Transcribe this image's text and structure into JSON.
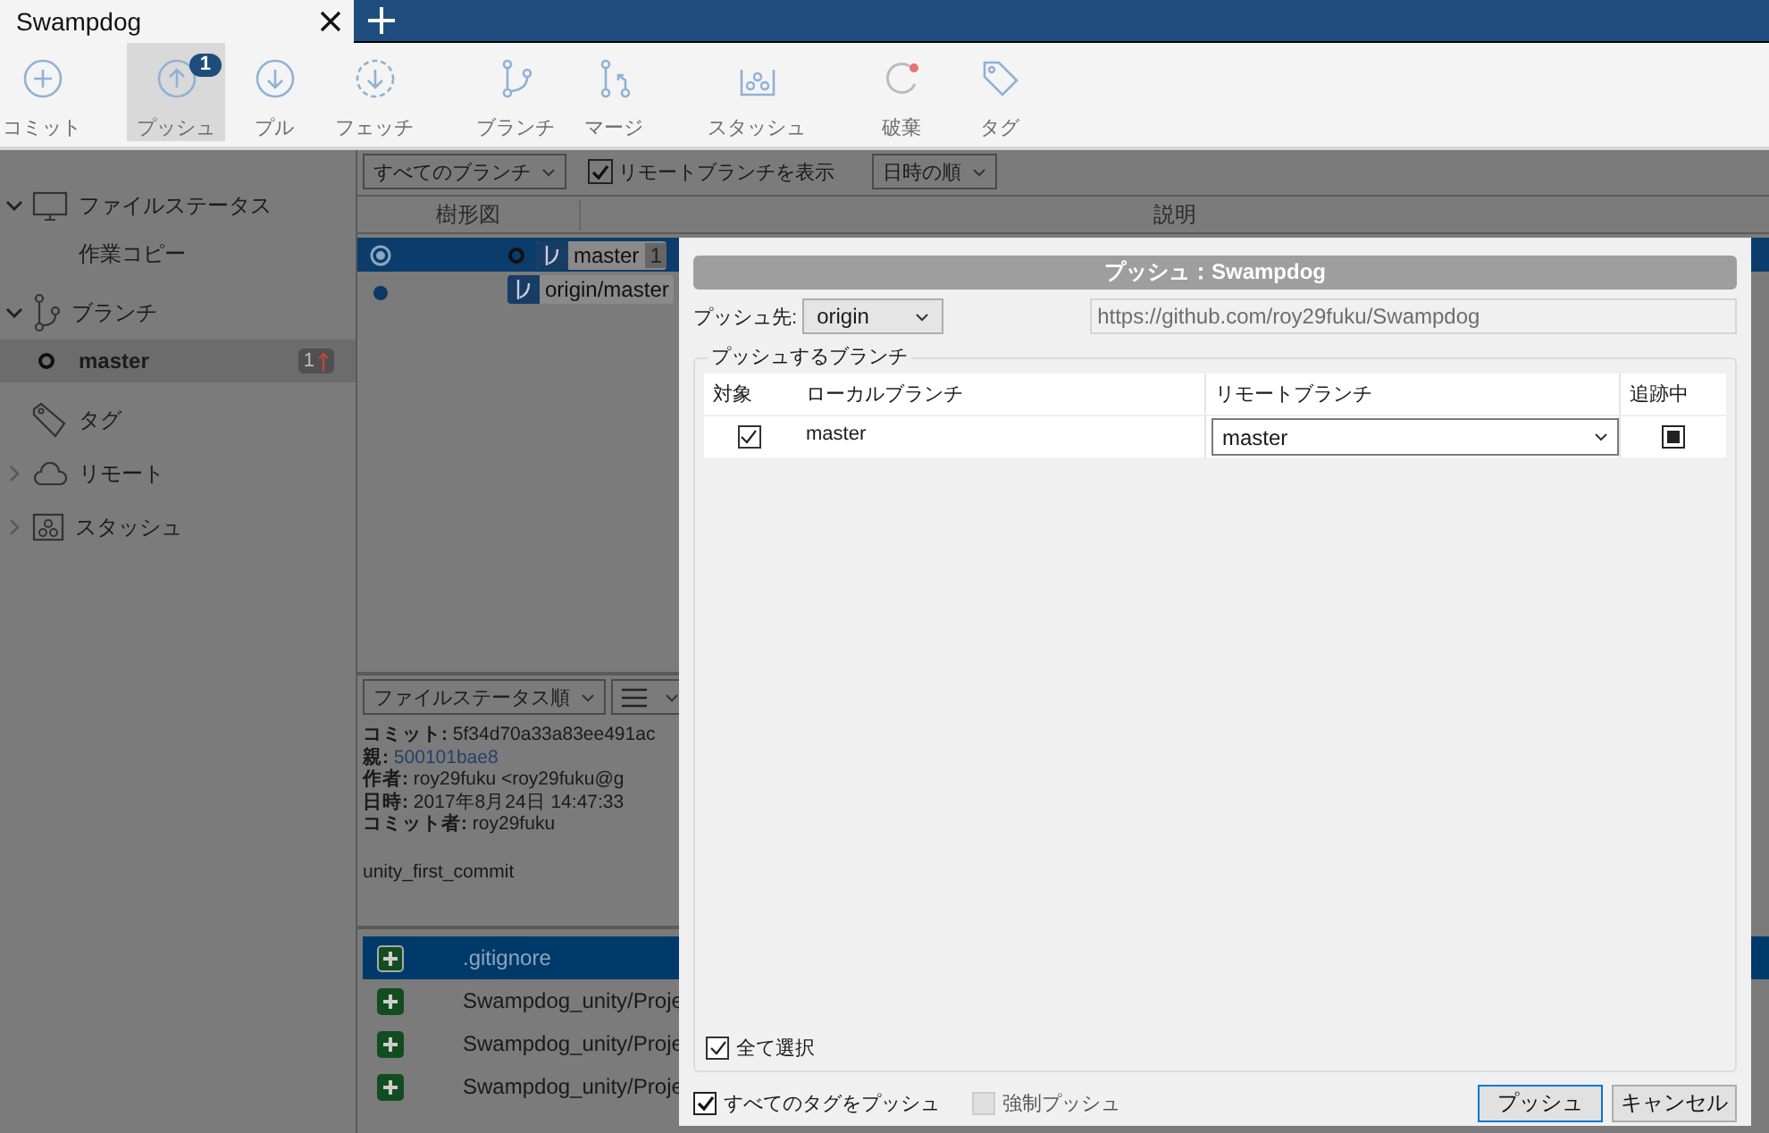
{
  "tab": {
    "title": "Swampdog"
  },
  "toolbar": [
    {
      "label": "コミット",
      "selected": false
    },
    {
      "label": "プッシュ",
      "selected": true,
      "badge": "1"
    },
    {
      "label": "プル",
      "selected": false
    },
    {
      "label": "フェッチ",
      "selected": false
    },
    {
      "label": "ブランチ",
      "selected": false
    },
    {
      "label": "マージ",
      "selected": false
    },
    {
      "label": "スタッシュ",
      "selected": false
    },
    {
      "label": "破棄",
      "selected": false
    },
    {
      "label": "タグ",
      "selected": false
    }
  ],
  "sidebar": {
    "sections": [
      {
        "label": "ファイルステータス",
        "expanded": true,
        "children": [
          {
            "label": "作業コピー",
            "selected": false
          }
        ]
      },
      {
        "label": "ブランチ",
        "expanded": true,
        "children": [
          {
            "label": "master",
            "selected": true,
            "badge": "1"
          }
        ]
      },
      {
        "label": "タグ"
      },
      {
        "label": "リモート",
        "expanded": false
      },
      {
        "label": "スタッシュ",
        "expanded": false
      }
    ]
  },
  "graph": {
    "branch_filter": "すべてのブランチ",
    "show_remote": {
      "label": "リモートブランチを表示",
      "checked": true
    },
    "sort": "日時の順",
    "columns": [
      "樹形図",
      "説明"
    ],
    "rows": [
      {
        "selected": true,
        "branches": [
          {
            "label": "master",
            "badge": "1",
            "head": true
          }
        ]
      },
      {
        "selected": false,
        "branches": [
          {
            "label": "origin/master",
            "head": false
          }
        ]
      }
    ]
  },
  "details": {
    "sort": "ファイルステータス順",
    "commit_info": [
      {
        "label": "コミット:",
        "value": "5f34d70a33a83ee491ac",
        "kind": "text"
      },
      {
        "label": "親:",
        "value": "500101bae8",
        "kind": "link"
      },
      {
        "label": "作者:",
        "value": "roy29fuku <roy29fuku@g",
        "kind": "text"
      },
      {
        "label": "日時:",
        "value": "2017年8月24日 14:47:33",
        "kind": "text"
      },
      {
        "label": "コミット者:",
        "value": "roy29fuku",
        "kind": "text"
      }
    ],
    "message": "unity_first_commit",
    "files": [
      {
        "name": ".gitignore",
        "selected": true
      },
      {
        "name": "Swampdog_unity/Proje",
        "selected": false
      },
      {
        "name": "Swampdog_unity/Proje",
        "selected": false
      },
      {
        "name": "Swampdog_unity/Proje",
        "selected": false
      }
    ]
  },
  "dialog": {
    "title": "プッシュ：Swampdog",
    "remote_label": "プッシュ先:",
    "remote": "origin",
    "url": "https://github.com/roy29fuku/Swampdog",
    "group": "プッシュするブランチ",
    "columns": [
      "対象",
      "ローカルブランチ",
      "リモートブランチ",
      "追跡中"
    ],
    "rows": [
      {
        "checked": true,
        "local": "master",
        "remote": "master",
        "tracking": true
      }
    ],
    "select_all": {
      "label": "全て選択",
      "checked": true
    },
    "push_tags": {
      "label": "すべてのタグをプッシュ",
      "checked": true
    },
    "force_push": {
      "label": "強制プッシュ",
      "checked": false,
      "disabled": true
    },
    "buttons": [
      {
        "label": "プッシュ",
        "kind": "primary"
      },
      {
        "label": "キャンセル",
        "kind": "default"
      }
    ]
  }
}
